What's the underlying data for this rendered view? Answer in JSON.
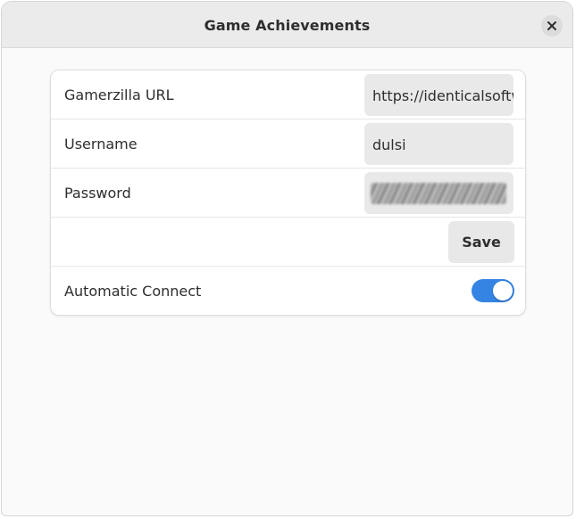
{
  "window": {
    "title": "Game Achievements",
    "close_icon": "close-icon"
  },
  "settings": {
    "gamerzilla_url": {
      "label": "Gamerzilla URL",
      "value": "https://identicalsoftware.com/gamerzilla/"
    },
    "username": {
      "label": "Username",
      "value": "dulsi"
    },
    "password": {
      "label": "Password",
      "value": "(obscured)"
    },
    "save_label": "Save",
    "automatic_connect": {
      "label": "Automatic Connect",
      "enabled": true
    }
  },
  "colors": {
    "accent": "#3584e4",
    "headerbar": "#ebebeb",
    "entry_bg": "#e9e9e9",
    "text": "#2e2e2e"
  }
}
